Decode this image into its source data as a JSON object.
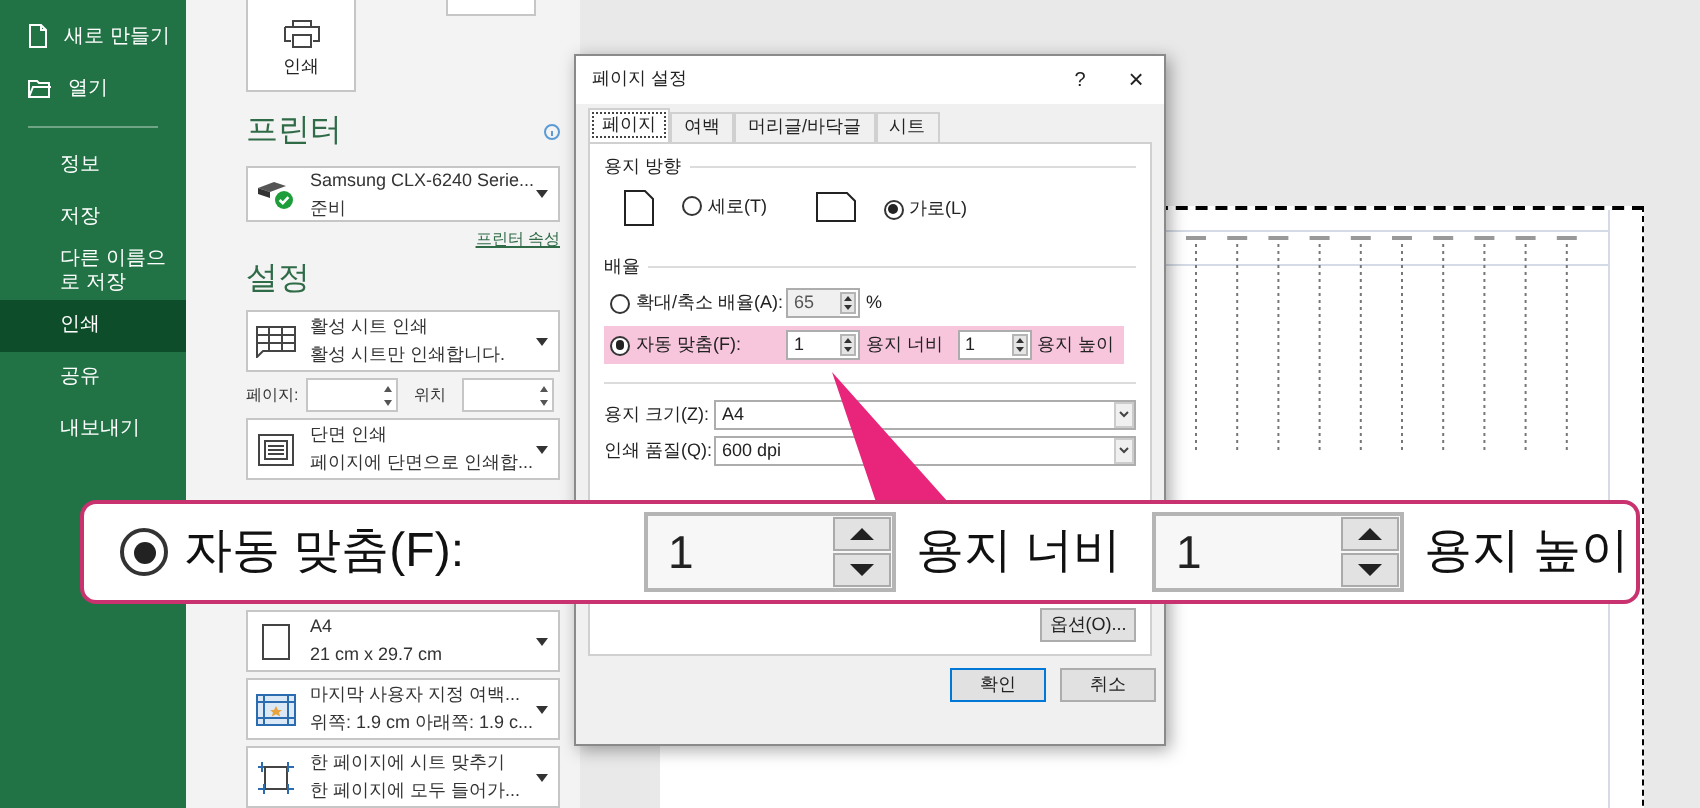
{
  "sidebar": {
    "items": [
      {
        "kind": "command",
        "label": "새로 만들기",
        "selected": false
      },
      {
        "kind": "command",
        "label": "열기",
        "selected": false
      },
      {
        "kind": "page",
        "label": "정보",
        "selected": false
      },
      {
        "kind": "page",
        "label": "저장",
        "selected": false
      },
      {
        "kind": "page",
        "label": "다른 이름으로 저장",
        "selected": false
      },
      {
        "kind": "page",
        "label": "인쇄",
        "selected": true
      },
      {
        "kind": "page",
        "label": "공유",
        "selected": false
      },
      {
        "kind": "page",
        "label": "내보내기",
        "selected": false
      }
    ]
  },
  "print_panel": {
    "print_button": "인쇄",
    "printer": {
      "heading": "프린터",
      "name": "Samsung CLX-6240 Serie...",
      "status": "준비",
      "properties_link": "프린터 속성"
    },
    "settings": {
      "heading": "설정",
      "pages_label": "페이지:",
      "to_label": "위치",
      "options": [
        {
          "title": "활성 시트 인쇄",
          "description": "활성 시트만 인쇄합니다."
        },
        {
          "title": "단면 인쇄",
          "description": "페이지에 단면으로 인쇄합..."
        },
        {
          "title": "A4",
          "description": "21 cm x 29.7 cm"
        },
        {
          "title": "마지막 사용자 지정 여백...",
          "description": "위쪽: 1.9 cm 아래쪽: 1.9 c..."
        },
        {
          "title": "한 페이지에 시트 맞추기",
          "description": "한 페이지에 모두 들어가..."
        }
      ]
    }
  },
  "dialog": {
    "title": "페이지 설정",
    "help": "?",
    "close": "×",
    "tabs": [
      {
        "label": "페이지",
        "selected": true
      },
      {
        "label": "여백",
        "selected": false
      },
      {
        "label": "머리글/바닥글",
        "selected": false
      },
      {
        "label": "시트",
        "selected": false
      }
    ],
    "orientation": {
      "heading": "용지 방향",
      "options": [
        {
          "label": "세로(T)",
          "selected": false
        },
        {
          "label": "가로(L)",
          "selected": true
        }
      ]
    },
    "scaling": {
      "heading": "배율",
      "options": [
        {
          "kind": "percent",
          "label": "확대/축소 배율(A):",
          "value": "65",
          "unit": "%",
          "selected": false,
          "disabled": true,
          "highlighted": false
        },
        {
          "kind": "fit",
          "label": "자동 맞춤(F):",
          "wide": "1",
          "wide_label": "용지 너비",
          "tall": "1",
          "tall_label": "용지 높이",
          "selected": true,
          "disabled": false,
          "highlighted": true
        }
      ]
    },
    "paper_size": {
      "label": "용지 크기(Z):",
      "value": "A4"
    },
    "print_quality": {
      "label": "인쇄 품질(Q):",
      "value": "600 dpi"
    },
    "options_button": "옵션(O)...",
    "buttons": [
      "확인",
      "취소"
    ]
  },
  "callout": {
    "label": "자동 맞춤(F):",
    "selected": true,
    "wide": "1",
    "wide_label": "용지 너비",
    "tall": "1",
    "tall_label": "용지 높이"
  }
}
